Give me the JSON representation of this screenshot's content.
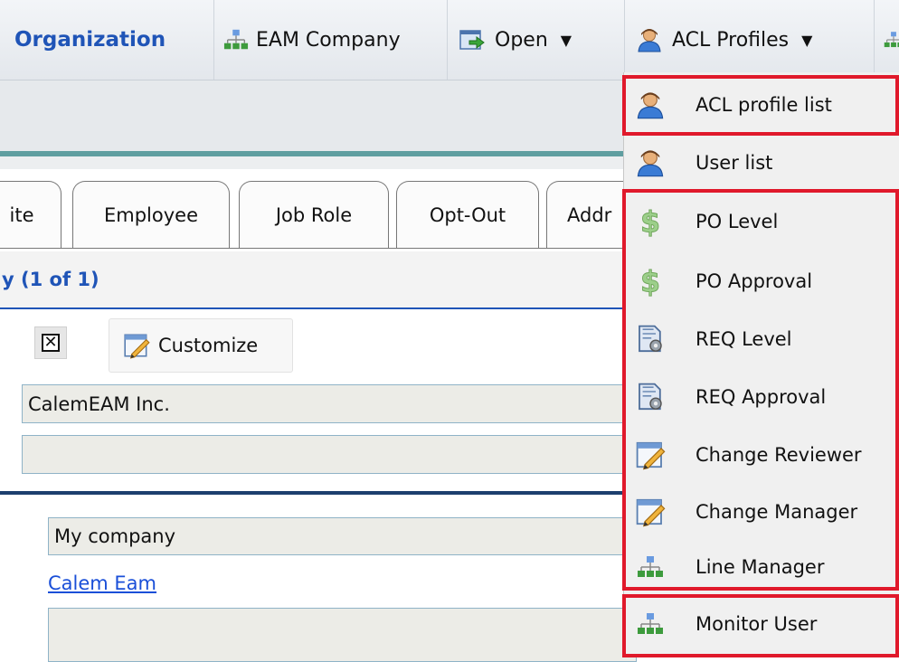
{
  "toolbar": {
    "org_label": "Organization",
    "eam_company_label": "EAM Company",
    "open_label": "Open",
    "acl_profiles_label": "ACL Profiles"
  },
  "tabs": [
    "ite",
    "Employee",
    "Job Role",
    "Opt-Out",
    "Addr"
  ],
  "section": {
    "title": "y (1 of 1)",
    "customize_label": "Customize",
    "company_name_value": "CalemEAM Inc.",
    "second_value": "",
    "description_value": "My company",
    "contact_link": "Calem Eam",
    "notes_value": ""
  },
  "menu": {
    "items": [
      {
        "label": "ACL profile list",
        "icon": "person-icon"
      },
      {
        "label": "User list",
        "icon": "person-icon"
      },
      {
        "label": "PO Level",
        "icon": "dollar-icon"
      },
      {
        "label": "PO Approval",
        "icon": "dollar-icon"
      },
      {
        "label": "REQ Level",
        "icon": "document-gear-icon"
      },
      {
        "label": "REQ Approval",
        "icon": "document-gear-icon"
      },
      {
        "label": "Change Reviewer",
        "icon": "edit-form-icon"
      },
      {
        "label": "Change Manager",
        "icon": "edit-form-icon"
      },
      {
        "label": "Line Manager",
        "icon": "org-chart-icon"
      },
      {
        "label": "Monitor User",
        "icon": "org-chart-icon"
      }
    ]
  },
  "colors": {
    "highlight": "#e0192b",
    "link": "#1a4fd8",
    "title_blue": "#1f54b7"
  }
}
